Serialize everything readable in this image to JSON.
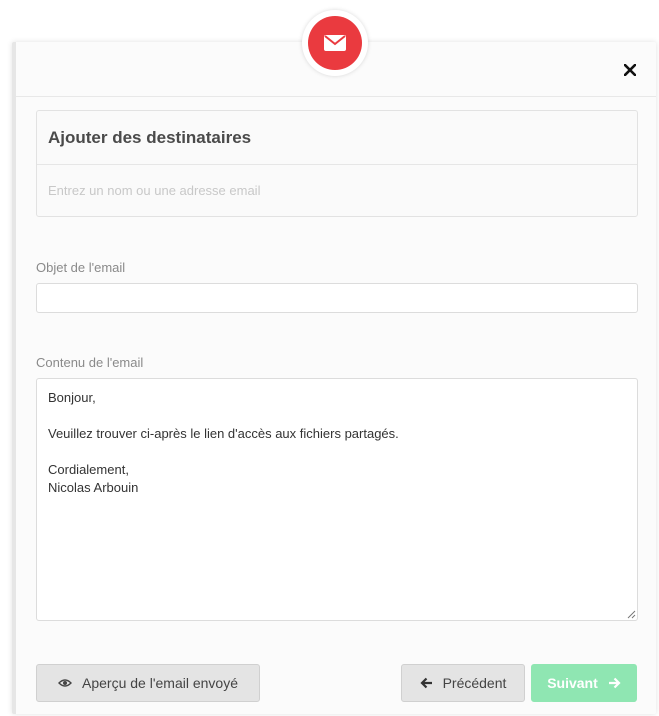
{
  "header": {
    "badge_icon": "envelope-icon",
    "badge_color": "#ea3a3f",
    "close_icon": "close-icon"
  },
  "recipients": {
    "title": "Ajouter des destinataires",
    "placeholder": "Entrez un nom ou une adresse email",
    "value": ""
  },
  "subject": {
    "label": "Objet de l'email",
    "value": ""
  },
  "content": {
    "label": "Contenu de l'email",
    "value": "Bonjour,\n\nVeuillez trouver ci-après le lien d'accès aux fichiers partagés.\n\nCordialement,\nNicolas Arbouin"
  },
  "footer": {
    "preview_label": "Aperçu de l'email envoyé",
    "preview_icon": "eye-icon",
    "previous_label": "Précédent",
    "previous_icon": "arrow-left-icon",
    "next_label": "Suivant",
    "next_icon": "arrow-right-icon",
    "next_color": "#8fe6b2"
  }
}
